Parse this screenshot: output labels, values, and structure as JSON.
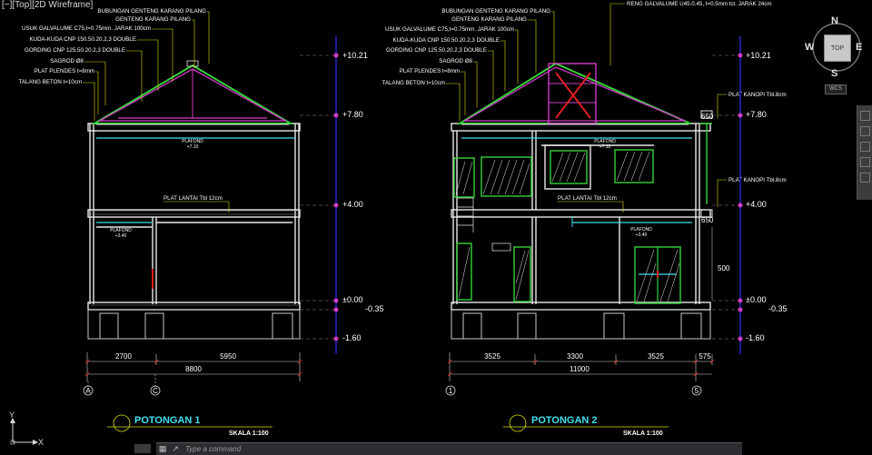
{
  "viewport": {
    "label": "[−][Top][2D Wireframe]"
  },
  "viewcube": {
    "north": "N",
    "south": "S",
    "east": "E",
    "west": "W",
    "top": "TOP",
    "wcs": "WCS"
  },
  "ucs": {
    "x": "X",
    "y": "Y"
  },
  "command": {
    "placeholder": "Type a command"
  },
  "section1": {
    "title": "POTONGAN 1",
    "scale": "SKALA 1:100",
    "roof_labels": [
      "BUBUNGAN GENTENG KARANG PILANG",
      "GENTENG KARANG PILANG",
      "USUK GALVALUME C75,t=0.75mm. JARAK 100cm",
      "KUDA-KUDA CNP 150.50.20.2,3 DOUBLE",
      "GORDING CNP 125.50.20.2,3 DOUBLE",
      "SAGROD Ø8",
      "PLAT PLENDES t=8mm",
      "TALANG BETON t=10cm"
    ],
    "elevations": [
      "+10.21",
      "+7.80",
      "+4.00",
      "±0.00",
      "-0.35",
      "-1.60"
    ],
    "plafond_upper": "PLAFOND",
    "plafond_upper_val": "+7.10",
    "plafond_lower": "PLAFOND",
    "plafond_lower_val": "+3.40",
    "plat_lantai": "PLAT LANTAI Tbl 12cm",
    "dims": [
      "2700",
      "5950"
    ],
    "total": "8800",
    "grids": [
      "A",
      "C"
    ]
  },
  "section2": {
    "title": "POTONGAN 2",
    "scale": "SKALA 1:100",
    "roof_labels": [
      "BUBUNGAN GENTENG KARANG PILANG",
      "GENTENG KARANG PILANG",
      "USUK GALVALUME C75,t=0.75mm. JARAK 100cm",
      "KUDA-KUDA CNP 150.50.20.2,3 DOUBLE",
      "GORDING CNP 125.50.20.2,3 DOUBLE",
      "SAGROD Ø8",
      "PLAT PLENDES t=8mm",
      "TALANG BETON t=10cm"
    ],
    "reng": "RENG GALVALUME U45.0.45, t=0.5mm tct. JARAK 24cm",
    "elevations": [
      "+10.21",
      "+7.80",
      "+4.00",
      "±0.00",
      "-0.35",
      "-1.60"
    ],
    "kanopi1": "PLAT KANOPI Tbl.8cm",
    "kanopi2": "PLAT KANOPI Tbl.8cm",
    "dim650a": "650",
    "dim650b": "650",
    "dim500": "500",
    "plafond_upper": "PLAFOND",
    "plafond_upper_val": "+7.10",
    "plafond_lower": "PLAFOND",
    "plafond_lower_val": "+3.40",
    "plat_lantai": "PLAT LANTAI Tbl 12cm",
    "dims": [
      "3525",
      "3300",
      "3525",
      "575"
    ],
    "total": "11000",
    "grids": [
      "1",
      "5"
    ]
  },
  "colors": {
    "bg": "#000000",
    "white": "#ffffff",
    "green": "#35d23a",
    "magenta": "#d23cc8",
    "cyan": "#40e0f0",
    "red": "#e02020",
    "blue": "#3030ff",
    "yellow": "#e8e000"
  }
}
